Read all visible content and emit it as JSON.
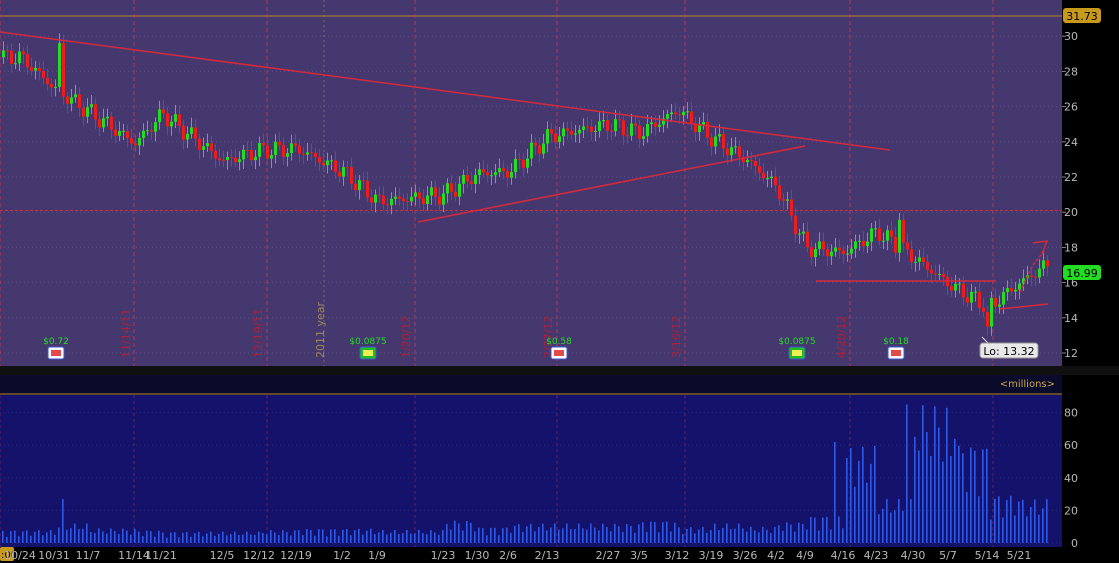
{
  "price_panel": {
    "last_high_label": "31.73",
    "current_price_label": "16.99",
    "low_label": "Lo: 13.32",
    "year_marker": "2011 year",
    "vertical_line_labels": [
      "11/14/11",
      "12/19/11",
      "1/20/12",
      "2/27/12",
      "3/16/12",
      "4/20/12"
    ],
    "dividends": [
      "$0.72",
      "$0.0875",
      "$0.58",
      "$0.0875",
      "$0.18"
    ]
  },
  "volume_panel": {
    "units_label": "<millions>"
  },
  "x_axis": {
    "start_label": ":00",
    "labels": [
      "10/24",
      "10/31",
      "11/7",
      "11/14",
      "11/21",
      "12/5",
      "12/12",
      "12/19",
      "1/2",
      "1/9",
      "1/23",
      "1/30",
      "2/6",
      "2/13",
      "2/27",
      "3/5",
      "3/12",
      "3/19",
      "3/26",
      "4/2",
      "4/9",
      "4/16",
      "4/23",
      "4/30",
      "5/7",
      "5/14",
      "5/21"
    ]
  },
  "colors": {
    "price_bg": "#45386f",
    "volume_bg": "#14126b",
    "up_candle": "#22dd22",
    "down_candle": "#ee1c1c",
    "trendline": "#d42a3c",
    "volume_bar": "#2f58e6",
    "badge_green": "#22bb22",
    "badge_gold": "#c79a1e"
  },
  "chart_data": [
    {
      "type": "line",
      "title": "",
      "xlabel": "",
      "ylabel": "",
      "ylim": [
        12,
        31.73
      ],
      "yticks": [
        12,
        14,
        16,
        18,
        20,
        22,
        24,
        26,
        28,
        30
      ],
      "grid": true,
      "series": [
        {
          "values": [
            {
              "x": "10/24",
              "y": 28.8
            },
            {
              "x": "10/31",
              "y": 27.0
            },
            {
              "x": "11/7",
              "y": 25.7
            },
            {
              "x": "11/14",
              "y": 23.9
            },
            {
              "x": "11/21",
              "y": 25.6
            },
            {
              "x": "12/5",
              "y": 22.9
            },
            {
              "x": "12/12",
              "y": 23.5
            },
            {
              "x": "12/19",
              "y": 23.6
            },
            {
              "x": "1/2",
              "y": 22.3
            },
            {
              "x": "1/9",
              "y": 20.6
            },
            {
              "x": "1/23",
              "y": 21.0
            },
            {
              "x": "1/30",
              "y": 22.2
            },
            {
              "x": "2/6",
              "y": 22.3
            },
            {
              "x": "2/13",
              "y": 24.3
            },
            {
              "x": "2/27",
              "y": 25.0
            },
            {
              "x": "3/5",
              "y": 24.5
            },
            {
              "x": "3/12",
              "y": 25.8
            },
            {
              "x": "3/19",
              "y": 24.2
            },
            {
              "x": "3/26",
              "y": 23.0
            },
            {
              "x": "4/2",
              "y": 21.4
            },
            {
              "x": "4/9",
              "y": 18.0
            },
            {
              "x": "4/16",
              "y": 17.7
            },
            {
              "x": "4/23",
              "y": 18.9
            },
            {
              "x": "4/30",
              "y": 17.4
            },
            {
              "x": "5/7",
              "y": 15.9
            },
            {
              "x": "5/14",
              "y": 14.6
            },
            {
              "x": "5/21",
              "y": 16.0
            },
            {
              "x": "5/28",
              "y": 16.99
            }
          ]
        }
      ],
      "annotations": [
        "31.73",
        "16.99",
        "Lo: 13.32",
        "2011 year"
      ]
    },
    {
      "type": "bar",
      "title": "",
      "ylabel": "<millions>",
      "ylim": [
        0,
        90
      ],
      "yticks": [
        0,
        20,
        40,
        60,
        80
      ],
      "categories": [
        "10/24",
        "10/31",
        "11/7",
        "11/14",
        "11/21",
        "12/5",
        "12/12",
        "12/19",
        "1/2",
        "1/9",
        "1/23",
        "1/30",
        "2/6",
        "2/13",
        "2/27",
        "3/5",
        "3/12",
        "3/19",
        "3/26",
        "4/2",
        "4/9",
        "4/16",
        "4/23",
        "4/30",
        "5/7",
        "5/14",
        "5/21"
      ],
      "values": [
        8,
        12,
        9,
        8,
        7,
        7,
        8,
        9,
        9,
        8,
        14,
        10,
        12,
        12,
        12,
        14,
        10,
        12,
        10,
        13,
        17,
        60,
        27,
        85,
        62,
        30,
        27
      ]
    }
  ]
}
